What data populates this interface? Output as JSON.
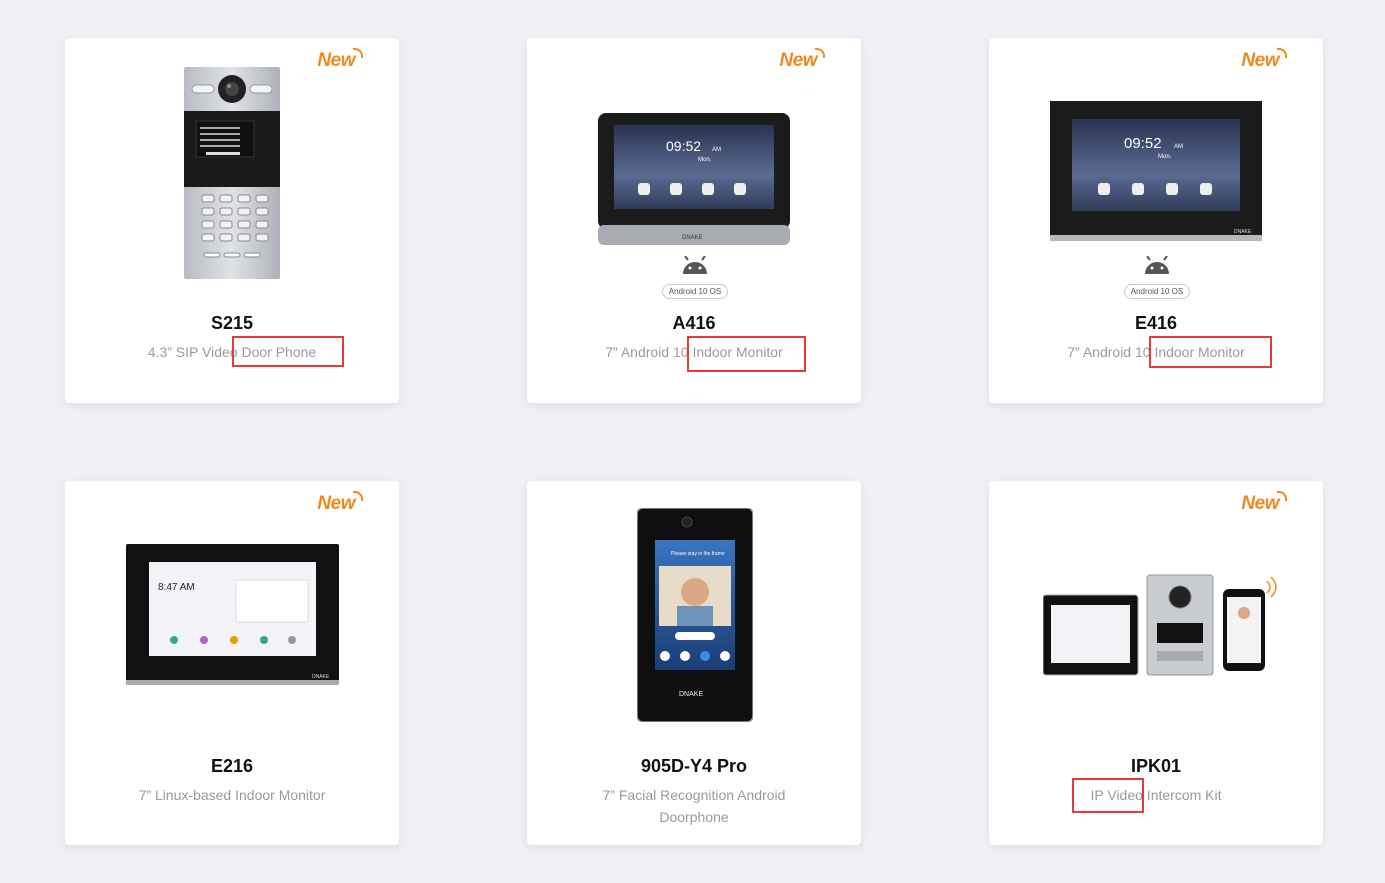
{
  "badge_text": "New",
  "android_label": "Android 10 OS",
  "products": [
    {
      "name": "S215",
      "desc": "4.3” SIP Video Door Phone",
      "new": true
    },
    {
      "name": "A416",
      "desc": "7” Android 10 Indoor Monitor",
      "new": true
    },
    {
      "name": "E416",
      "desc": "7” Android 10 Indoor Monitor",
      "new": true
    },
    {
      "name": "E216",
      "desc": "7” Linux-based Indoor Monitor",
      "new": true
    },
    {
      "name": "905D-Y4 Pro",
      "desc": "7” Facial Recognition Android Doorphone",
      "new": false
    },
    {
      "name": "IPK01",
      "desc": "IP Video Intercom Kit",
      "new": true
    }
  ],
  "screen_text": {
    "time": "09:52",
    "ampm": "AM",
    "day": "Mon.",
    "e216_time": "8:47 AM",
    "face_prompt": "Please stay in the frame",
    "brand": "DNAKE"
  },
  "colors": {
    "badge": "#f08a1c",
    "highlight": "#e23c3c",
    "background": "#eef0f5"
  }
}
